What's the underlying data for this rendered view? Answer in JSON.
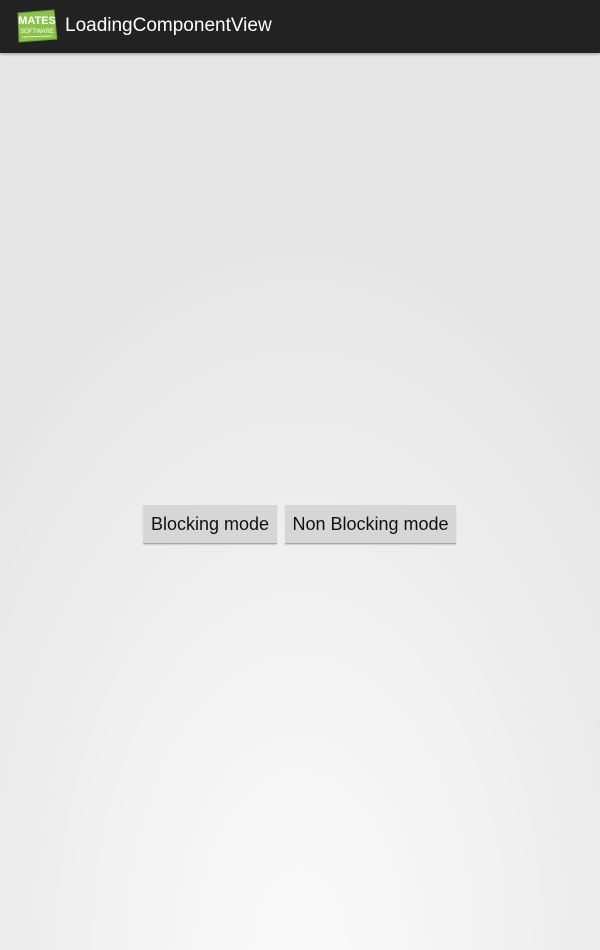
{
  "action_bar": {
    "title": "LoadingComponentView",
    "logo_text": "MATES",
    "logo_subtext": "SOFTWARE"
  },
  "main": {
    "blocking_button_label": "Blocking mode",
    "non_blocking_button_label": "Non Blocking mode"
  },
  "colors": {
    "action_bar_bg": "#222222",
    "logo_green": "#8bc34a",
    "button_bg": "#d6d6d6",
    "background": "#ededed"
  }
}
